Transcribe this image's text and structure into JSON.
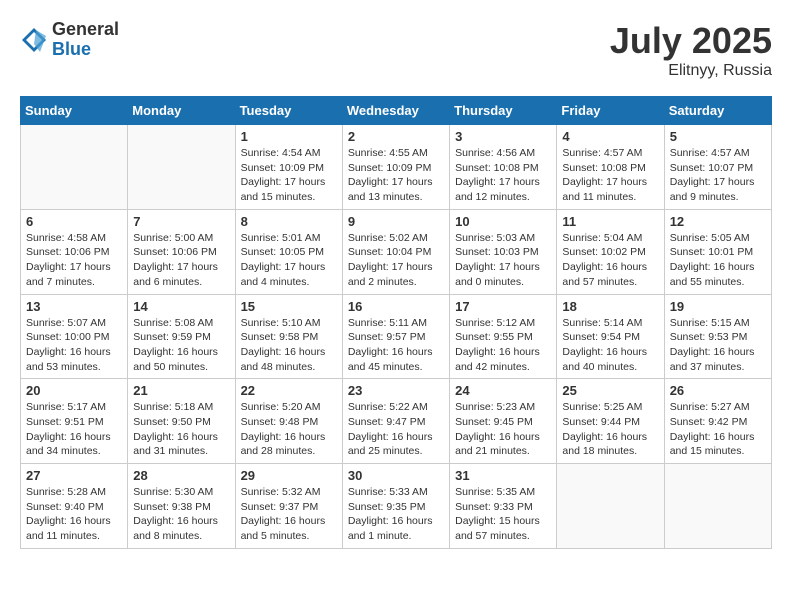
{
  "header": {
    "logo_general": "General",
    "logo_blue": "Blue",
    "month": "July 2025",
    "location": "Elitnyy, Russia"
  },
  "days_of_week": [
    "Sunday",
    "Monday",
    "Tuesday",
    "Wednesday",
    "Thursday",
    "Friday",
    "Saturday"
  ],
  "weeks": [
    [
      {
        "day": "",
        "info": ""
      },
      {
        "day": "",
        "info": ""
      },
      {
        "day": "1",
        "info": "Sunrise: 4:54 AM\nSunset: 10:09 PM\nDaylight: 17 hours and 15 minutes."
      },
      {
        "day": "2",
        "info": "Sunrise: 4:55 AM\nSunset: 10:09 PM\nDaylight: 17 hours and 13 minutes."
      },
      {
        "day": "3",
        "info": "Sunrise: 4:56 AM\nSunset: 10:08 PM\nDaylight: 17 hours and 12 minutes."
      },
      {
        "day": "4",
        "info": "Sunrise: 4:57 AM\nSunset: 10:08 PM\nDaylight: 17 hours and 11 minutes."
      },
      {
        "day": "5",
        "info": "Sunrise: 4:57 AM\nSunset: 10:07 PM\nDaylight: 17 hours and 9 minutes."
      }
    ],
    [
      {
        "day": "6",
        "info": "Sunrise: 4:58 AM\nSunset: 10:06 PM\nDaylight: 17 hours and 7 minutes."
      },
      {
        "day": "7",
        "info": "Sunrise: 5:00 AM\nSunset: 10:06 PM\nDaylight: 17 hours and 6 minutes."
      },
      {
        "day": "8",
        "info": "Sunrise: 5:01 AM\nSunset: 10:05 PM\nDaylight: 17 hours and 4 minutes."
      },
      {
        "day": "9",
        "info": "Sunrise: 5:02 AM\nSunset: 10:04 PM\nDaylight: 17 hours and 2 minutes."
      },
      {
        "day": "10",
        "info": "Sunrise: 5:03 AM\nSunset: 10:03 PM\nDaylight: 17 hours and 0 minutes."
      },
      {
        "day": "11",
        "info": "Sunrise: 5:04 AM\nSunset: 10:02 PM\nDaylight: 16 hours and 57 minutes."
      },
      {
        "day": "12",
        "info": "Sunrise: 5:05 AM\nSunset: 10:01 PM\nDaylight: 16 hours and 55 minutes."
      }
    ],
    [
      {
        "day": "13",
        "info": "Sunrise: 5:07 AM\nSunset: 10:00 PM\nDaylight: 16 hours and 53 minutes."
      },
      {
        "day": "14",
        "info": "Sunrise: 5:08 AM\nSunset: 9:59 PM\nDaylight: 16 hours and 50 minutes."
      },
      {
        "day": "15",
        "info": "Sunrise: 5:10 AM\nSunset: 9:58 PM\nDaylight: 16 hours and 48 minutes."
      },
      {
        "day": "16",
        "info": "Sunrise: 5:11 AM\nSunset: 9:57 PM\nDaylight: 16 hours and 45 minutes."
      },
      {
        "day": "17",
        "info": "Sunrise: 5:12 AM\nSunset: 9:55 PM\nDaylight: 16 hours and 42 minutes."
      },
      {
        "day": "18",
        "info": "Sunrise: 5:14 AM\nSunset: 9:54 PM\nDaylight: 16 hours and 40 minutes."
      },
      {
        "day": "19",
        "info": "Sunrise: 5:15 AM\nSunset: 9:53 PM\nDaylight: 16 hours and 37 minutes."
      }
    ],
    [
      {
        "day": "20",
        "info": "Sunrise: 5:17 AM\nSunset: 9:51 PM\nDaylight: 16 hours and 34 minutes."
      },
      {
        "day": "21",
        "info": "Sunrise: 5:18 AM\nSunset: 9:50 PM\nDaylight: 16 hours and 31 minutes."
      },
      {
        "day": "22",
        "info": "Sunrise: 5:20 AM\nSunset: 9:48 PM\nDaylight: 16 hours and 28 minutes."
      },
      {
        "day": "23",
        "info": "Sunrise: 5:22 AM\nSunset: 9:47 PM\nDaylight: 16 hours and 25 minutes."
      },
      {
        "day": "24",
        "info": "Sunrise: 5:23 AM\nSunset: 9:45 PM\nDaylight: 16 hours and 21 minutes."
      },
      {
        "day": "25",
        "info": "Sunrise: 5:25 AM\nSunset: 9:44 PM\nDaylight: 16 hours and 18 minutes."
      },
      {
        "day": "26",
        "info": "Sunrise: 5:27 AM\nSunset: 9:42 PM\nDaylight: 16 hours and 15 minutes."
      }
    ],
    [
      {
        "day": "27",
        "info": "Sunrise: 5:28 AM\nSunset: 9:40 PM\nDaylight: 16 hours and 11 minutes."
      },
      {
        "day": "28",
        "info": "Sunrise: 5:30 AM\nSunset: 9:38 PM\nDaylight: 16 hours and 8 minutes."
      },
      {
        "day": "29",
        "info": "Sunrise: 5:32 AM\nSunset: 9:37 PM\nDaylight: 16 hours and 5 minutes."
      },
      {
        "day": "30",
        "info": "Sunrise: 5:33 AM\nSunset: 9:35 PM\nDaylight: 16 hours and 1 minute."
      },
      {
        "day": "31",
        "info": "Sunrise: 5:35 AM\nSunset: 9:33 PM\nDaylight: 15 hours and 57 minutes."
      },
      {
        "day": "",
        "info": ""
      },
      {
        "day": "",
        "info": ""
      }
    ]
  ]
}
